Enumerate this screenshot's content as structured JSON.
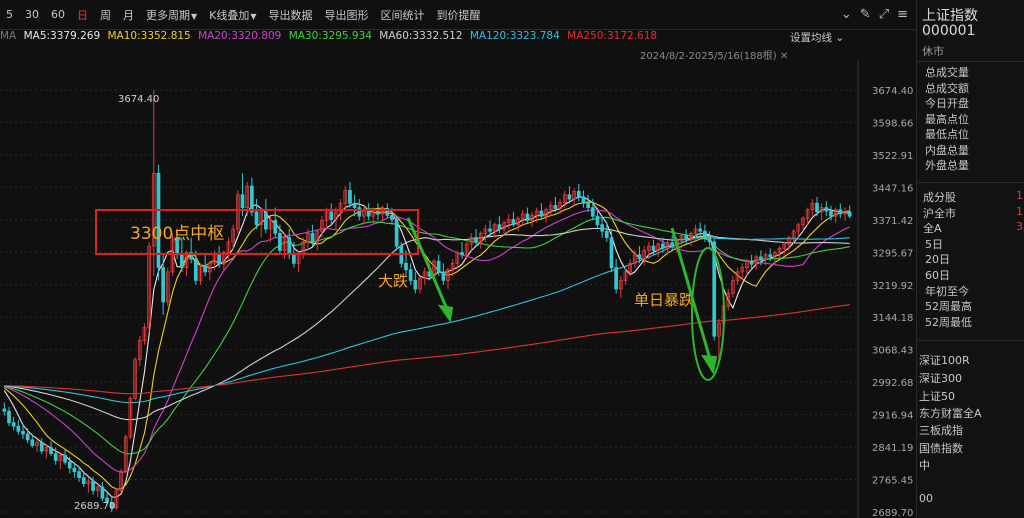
{
  "toolbar": {
    "periods": [
      "5",
      "30",
      "60",
      "日",
      "周",
      "月"
    ],
    "active_period": "日",
    "menus": [
      "更多周期",
      "K线叠加",
      "导出数据",
      "导出图形",
      "区间统计",
      "到价提醒"
    ]
  },
  "indicator_label": "MA",
  "ma_legend": [
    {
      "label": "MA5:3379.269",
      "color": "#e8e8e8"
    },
    {
      "label": "MA10:3352.815",
      "color": "#f0d020"
    },
    {
      "label": "MA20:3320.809",
      "color": "#d040d0"
    },
    {
      "label": "MA30:3295.934",
      "color": "#40d040"
    },
    {
      "label": "MA60:3332.512",
      "color": "#d0d0d0"
    },
    {
      "label": "MA120:3323.784",
      "color": "#30c0e0"
    },
    {
      "label": "MA250:3172.618",
      "color": "#e03030"
    }
  ],
  "set_ma_label": "设置均线",
  "date_range": "2024/8/2-2025/5/16(188根)",
  "annotations": {
    "box_label": "3300点中枢",
    "drop_label": "大跌",
    "single_day_label": "单日暴跌",
    "high_label": "3674.40",
    "low_label": "2689.70"
  },
  "colors": {
    "up": "#e23b3b",
    "down": "#35c7d0",
    "box": "#e02020",
    "annotation_text": "#f5a623",
    "arrow": "#2db52d"
  },
  "chart_data": {
    "type": "candlestick",
    "y_ticks": [
      "3674.40",
      "3598.66",
      "3522.91",
      "3447.16",
      "3371.42",
      "3295.67",
      "3219.92",
      "3144.18",
      "3068.43",
      "2992.68",
      "2916.94",
      "2841.19",
      "2765.45",
      "2689.70"
    ],
    "ylim": [
      2689.7,
      3674.4
    ],
    "n_bars": 188,
    "ohlc": [
      [
        2930,
        2945,
        2915,
        2925
      ],
      [
        2925,
        2935,
        2890,
        2898
      ],
      [
        2898,
        2912,
        2880,
        2890
      ],
      [
        2890,
        2905,
        2870,
        2878
      ],
      [
        2878,
        2895,
        2860,
        2872
      ],
      [
        2872,
        2885,
        2850,
        2858
      ],
      [
        2858,
        2870,
        2840,
        2845
      ],
      [
        2845,
        2860,
        2830,
        2852
      ],
      [
        2852,
        2862,
        2825,
        2832
      ],
      [
        2832,
        2848,
        2815,
        2840
      ],
      [
        2840,
        2855,
        2820,
        2826
      ],
      [
        2826,
        2840,
        2800,
        2810
      ],
      [
        2810,
        2830,
        2790,
        2822
      ],
      [
        2822,
        2835,
        2800,
        2806
      ],
      [
        2806,
        2818,
        2780,
        2792
      ],
      [
        2792,
        2805,
        2770,
        2784
      ],
      [
        2784,
        2796,
        2760,
        2770
      ],
      [
        2770,
        2785,
        2748,
        2756
      ],
      [
        2756,
        2770,
        2735,
        2762
      ],
      [
        2762,
        2772,
        2730,
        2740
      ],
      [
        2740,
        2755,
        2725,
        2748
      ],
      [
        2748,
        2760,
        2715,
        2722
      ],
      [
        2722,
        2738,
        2705,
        2712
      ],
      [
        2712,
        2728,
        2690,
        2700
      ],
      [
        2700,
        2745,
        2695,
        2740
      ],
      [
        2740,
        2790,
        2735,
        2785
      ],
      [
        2785,
        2870,
        2780,
        2865
      ],
      [
        2865,
        2960,
        2860,
        2955
      ],
      [
        2955,
        3050,
        2950,
        3045
      ],
      [
        3045,
        3100,
        3030,
        3090
      ],
      [
        3090,
        3130,
        3080,
        3120
      ],
      [
        3120,
        3320,
        3110,
        3310
      ],
      [
        3310,
        3674,
        3240,
        3480
      ],
      [
        3480,
        3500,
        3230,
        3260
      ],
      [
        3260,
        3290,
        3150,
        3180
      ],
      [
        3180,
        3260,
        3170,
        3250
      ],
      [
        3250,
        3340,
        3240,
        3330
      ],
      [
        3330,
        3350,
        3280,
        3290
      ],
      [
        3290,
        3330,
        3250,
        3260
      ],
      [
        3260,
        3300,
        3240,
        3295
      ],
      [
        3295,
        3330,
        3270,
        3280
      ],
      [
        3280,
        3300,
        3220,
        3230
      ],
      [
        3230,
        3270,
        3220,
        3265
      ],
      [
        3265,
        3290,
        3240,
        3250
      ],
      [
        3250,
        3275,
        3230,
        3270
      ],
      [
        3270,
        3300,
        3255,
        3290
      ],
      [
        3290,
        3310,
        3260,
        3268
      ],
      [
        3268,
        3300,
        3250,
        3295
      ],
      [
        3295,
        3330,
        3280,
        3320
      ],
      [
        3320,
        3360,
        3300,
        3350
      ],
      [
        3350,
        3440,
        3340,
        3430
      ],
      [
        3430,
        3480,
        3380,
        3400
      ],
      [
        3400,
        3460,
        3380,
        3450
      ],
      [
        3450,
        3470,
        3380,
        3390
      ],
      [
        3390,
        3420,
        3350,
        3360
      ],
      [
        3360,
        3400,
        3330,
        3390
      ],
      [
        3390,
        3420,
        3340,
        3350
      ],
      [
        3350,
        3380,
        3320,
        3370
      ],
      [
        3370,
        3400,
        3330,
        3340
      ],
      [
        3340,
        3360,
        3290,
        3300
      ],
      [
        3300,
        3340,
        3280,
        3330
      ],
      [
        3330,
        3350,
        3280,
        3290
      ],
      [
        3290,
        3320,
        3260,
        3270
      ],
      [
        3270,
        3300,
        3250,
        3290
      ],
      [
        3290,
        3330,
        3280,
        3320
      ],
      [
        3320,
        3350,
        3300,
        3340
      ],
      [
        3340,
        3360,
        3310,
        3320
      ],
      [
        3320,
        3350,
        3300,
        3345
      ],
      [
        3345,
        3380,
        3330,
        3370
      ],
      [
        3370,
        3400,
        3350,
        3390
      ],
      [
        3390,
        3410,
        3360,
        3372
      ],
      [
        3372,
        3400,
        3350,
        3390
      ],
      [
        3390,
        3420,
        3370,
        3410
      ],
      [
        3410,
        3450,
        3390,
        3440
      ],
      [
        3440,
        3460,
        3400,
        3410
      ],
      [
        3410,
        3430,
        3380,
        3400
      ],
      [
        3400,
        3420,
        3370,
        3380
      ],
      [
        3380,
        3400,
        3360,
        3392
      ],
      [
        3392,
        3410,
        3370,
        3380
      ],
      [
        3380,
        3400,
        3360,
        3394
      ],
      [
        3394,
        3410,
        3370,
        3385
      ],
      [
        3385,
        3405,
        3370,
        3398
      ],
      [
        3398,
        3410,
        3375,
        3382
      ],
      [
        3382,
        3400,
        3360,
        3372
      ],
      [
        3372,
        3380,
        3300,
        3310
      ],
      [
        3310,
        3320,
        3260,
        3270
      ],
      [
        3270,
        3300,
        3240,
        3255
      ],
      [
        3255,
        3270,
        3220,
        3230
      ],
      [
        3230,
        3250,
        3200,
        3210
      ],
      [
        3210,
        3240,
        3200,
        3235
      ],
      [
        3235,
        3260,
        3220,
        3250
      ],
      [
        3250,
        3270,
        3230,
        3240
      ],
      [
        3240,
        3280,
        3230,
        3275
      ],
      [
        3275,
        3290,
        3240,
        3250
      ],
      [
        3250,
        3270,
        3220,
        3230
      ],
      [
        3230,
        3260,
        3210,
        3255
      ],
      [
        3255,
        3280,
        3240,
        3270
      ],
      [
        3270,
        3300,
        3260,
        3295
      ],
      [
        3295,
        3320,
        3280,
        3290
      ],
      [
        3290,
        3320,
        3280,
        3315
      ],
      [
        3315,
        3340,
        3300,
        3330
      ],
      [
        3330,
        3350,
        3310,
        3320
      ],
      [
        3320,
        3345,
        3305,
        3340
      ],
      [
        3340,
        3360,
        3320,
        3350
      ],
      [
        3350,
        3370,
        3330,
        3345
      ],
      [
        3345,
        3365,
        3330,
        3360
      ],
      [
        3360,
        3380,
        3340,
        3350
      ],
      [
        3350,
        3370,
        3335,
        3365
      ],
      [
        3365,
        3385,
        3350,
        3372
      ],
      [
        3372,
        3390,
        3355,
        3360
      ],
      [
        3360,
        3380,
        3345,
        3375
      ],
      [
        3375,
        3395,
        3360,
        3385
      ],
      [
        3385,
        3400,
        3365,
        3370
      ],
      [
        3370,
        3390,
        3355,
        3382
      ],
      [
        3382,
        3400,
        3365,
        3392
      ],
      [
        3392,
        3410,
        3375,
        3380
      ],
      [
        3380,
        3400,
        3365,
        3395
      ],
      [
        3395,
        3415,
        3380,
        3405
      ],
      [
        3405,
        3425,
        3390,
        3398
      ],
      [
        3398,
        3420,
        3385,
        3412
      ],
      [
        3412,
        3440,
        3400,
        3430
      ],
      [
        3430,
        3450,
        3410,
        3420
      ],
      [
        3420,
        3445,
        3405,
        3438
      ],
      [
        3438,
        3455,
        3415,
        3425
      ],
      [
        3425,
        3440,
        3400,
        3410
      ],
      [
        3410,
        3430,
        3390,
        3400
      ],
      [
        3400,
        3420,
        3370,
        3380
      ],
      [
        3380,
        3400,
        3350,
        3360
      ],
      [
        3360,
        3380,
        3330,
        3345
      ],
      [
        3345,
        3365,
        3320,
        3330
      ],
      [
        3330,
        3345,
        3250,
        3260
      ],
      [
        3260,
        3280,
        3200,
        3210
      ],
      [
        3210,
        3240,
        3190,
        3230
      ],
      [
        3230,
        3260,
        3220,
        3250
      ],
      [
        3250,
        3280,
        3240,
        3270
      ],
      [
        3270,
        3300,
        3260,
        3290
      ],
      [
        3290,
        3310,
        3270,
        3280
      ],
      [
        3280,
        3310,
        3265,
        3300
      ],
      [
        3300,
        3320,
        3280,
        3310
      ],
      [
        3310,
        3325,
        3290,
        3300
      ],
      [
        3300,
        3320,
        3285,
        3315
      ],
      [
        3315,
        3330,
        3295,
        3305
      ],
      [
        3305,
        3325,
        3290,
        3318
      ],
      [
        3318,
        3335,
        3300,
        3310
      ],
      [
        3310,
        3330,
        3295,
        3322
      ],
      [
        3322,
        3340,
        3305,
        3335
      ],
      [
        3335,
        3350,
        3315,
        3328
      ],
      [
        3328,
        3345,
        3310,
        3340
      ],
      [
        3340,
        3360,
        3325,
        3350
      ],
      [
        3350,
        3365,
        3330,
        3345
      ],
      [
        3345,
        3360,
        3320,
        3330
      ],
      [
        3330,
        3345,
        3310,
        3320
      ],
      [
        3320,
        3330,
        3090,
        3100
      ],
      [
        3100,
        3140,
        3040,
        3130
      ],
      [
        3130,
        3180,
        3110,
        3170
      ],
      [
        3170,
        3210,
        3160,
        3200
      ],
      [
        3200,
        3240,
        3190,
        3230
      ],
      [
        3230,
        3260,
        3220,
        3250
      ],
      [
        3250,
        3270,
        3230,
        3260
      ],
      [
        3260,
        3280,
        3240,
        3275
      ],
      [
        3275,
        3290,
        3255,
        3268
      ],
      [
        3268,
        3290,
        3255,
        3285
      ],
      [
        3285,
        3300,
        3265,
        3278
      ],
      [
        3278,
        3295,
        3265,
        3290
      ],
      [
        3290,
        3305,
        3275,
        3285
      ],
      [
        3285,
        3300,
        3270,
        3295
      ],
      [
        3295,
        3310,
        3280,
        3305
      ],
      [
        3305,
        3320,
        3290,
        3315
      ],
      [
        3315,
        3335,
        3300,
        3330
      ],
      [
        3330,
        3350,
        3315,
        3345
      ],
      [
        3345,
        3365,
        3330,
        3360
      ],
      [
        3360,
        3380,
        3345,
        3375
      ],
      [
        3375,
        3400,
        3360,
        3395
      ],
      [
        3395,
        3420,
        3380,
        3410
      ],
      [
        3410,
        3425,
        3380,
        3390
      ],
      [
        3390,
        3410,
        3370,
        3400
      ],
      [
        3400,
        3415,
        3380,
        3392
      ],
      [
        3392,
        3405,
        3370,
        3380
      ],
      [
        3380,
        3400,
        3365,
        3395
      ],
      [
        3395,
        3410,
        3375,
        3385
      ],
      [
        3385,
        3400,
        3370,
        3390
      ],
      [
        3390,
        3405,
        3375,
        3380
      ]
    ]
  },
  "panel": {
    "name": "上证指数",
    "code": "000001",
    "status": "休市",
    "stats": [
      "总成交量",
      "总成交额",
      "今日开盘",
      "最高点位",
      "最低点位",
      "内盘总量",
      "外盘总量"
    ],
    "constituents": [
      {
        "label": "成分股",
        "value": "1"
      },
      {
        "label": "沪全市",
        "value": "1"
      },
      {
        "label": "全A",
        "value": "3"
      },
      {
        "label": "5日",
        "value": ""
      },
      {
        "label": "20日",
        "value": ""
      },
      {
        "label": "60日",
        "value": ""
      },
      {
        "label": "年初至今",
        "value": ""
      },
      {
        "label": "52周最高",
        "value": ""
      },
      {
        "label": "52周最低",
        "value": ""
      }
    ],
    "related": [
      "深证100R",
      "深证300",
      "上证50",
      "东方财富全A",
      "三板成指",
      "国债指数",
      "中",
      "",
      "00"
    ]
  }
}
